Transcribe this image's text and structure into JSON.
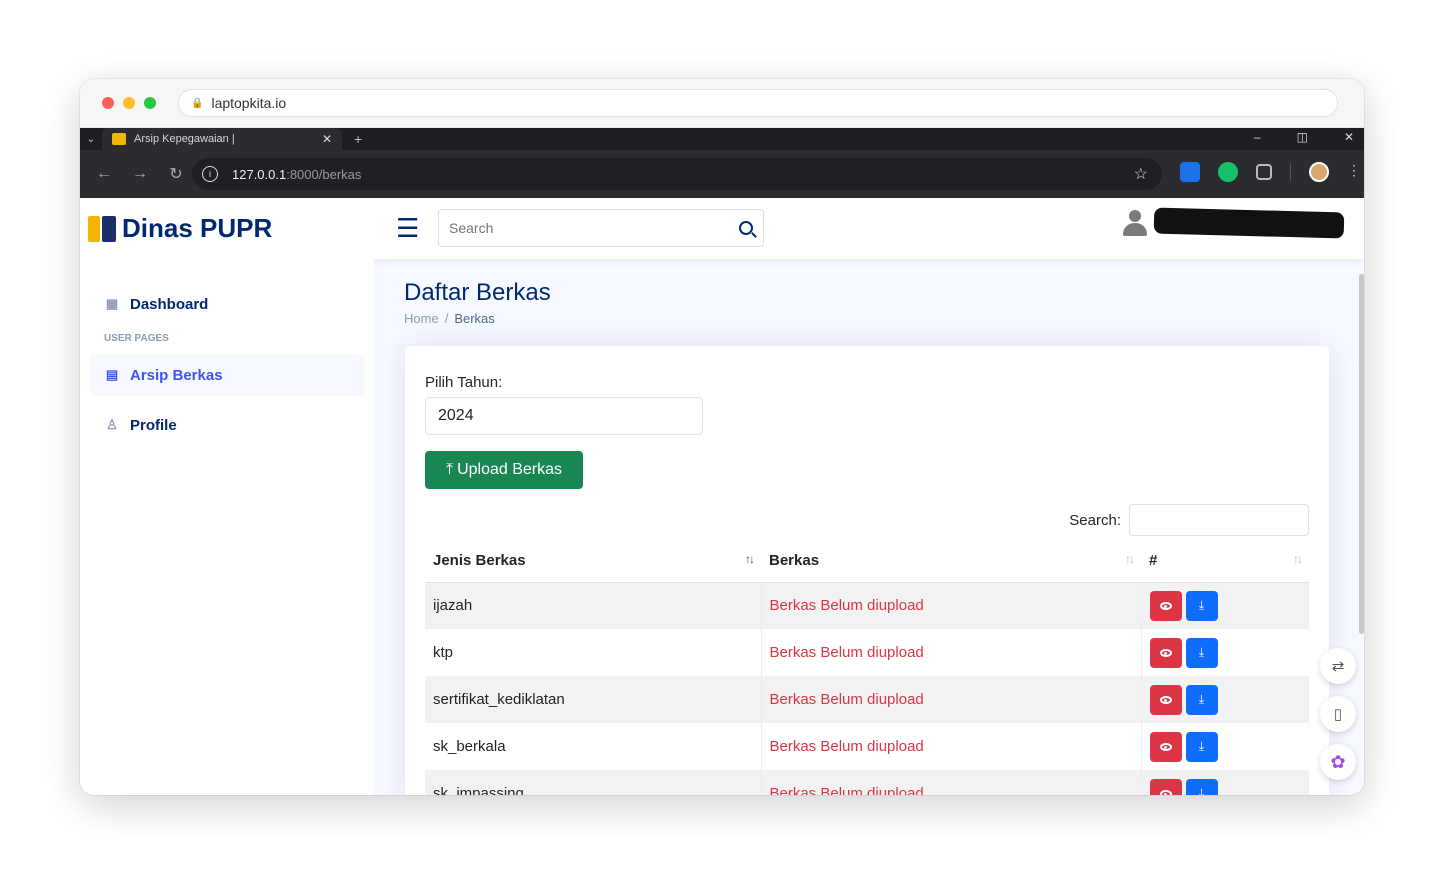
{
  "mac": {
    "url": "laptopkita.io"
  },
  "chrome": {
    "tab_title": "Arsip Kepegawaian |",
    "url_host": "127.0.0.1",
    "url_path": ":8000/berkas"
  },
  "topbar": {
    "brand": "Dinas PUPR",
    "search_placeholder": "Search"
  },
  "sidebar": {
    "items": [
      {
        "label": "Dashboard",
        "icon": "grid-icon"
      },
      {
        "label": "Arsip Berkas",
        "icon": "archive-icon"
      },
      {
        "label": "Profile",
        "icon": "person-icon"
      }
    ],
    "heading": "USER PAGES"
  },
  "main": {
    "title": "Daftar Berkas",
    "breadcrumb": [
      "Home",
      "Berkas"
    ],
    "year_label": "Pilih Tahun:",
    "year_value": "2024",
    "upload_label": "Upload Berkas",
    "search_label": "Search:"
  },
  "table": {
    "headers": [
      "Jenis Berkas",
      "Berkas",
      "#"
    ],
    "rows": [
      {
        "jenis": "ijazah",
        "berkas": "Berkas Belum diupload"
      },
      {
        "jenis": "ktp",
        "berkas": "Berkas Belum diupload"
      },
      {
        "jenis": "sertifikat_kediklatan",
        "berkas": "Berkas Belum diupload"
      },
      {
        "jenis": "sk_berkala",
        "berkas": "Berkas Belum diupload"
      },
      {
        "jenis": "sk_impassing",
        "berkas": "Berkas Belum diupload"
      }
    ]
  },
  "colors": {
    "brand": "#012970",
    "accent": "#4154f1",
    "success": "#198754",
    "danger": "#dc3545",
    "primary": "#0d6efd"
  }
}
